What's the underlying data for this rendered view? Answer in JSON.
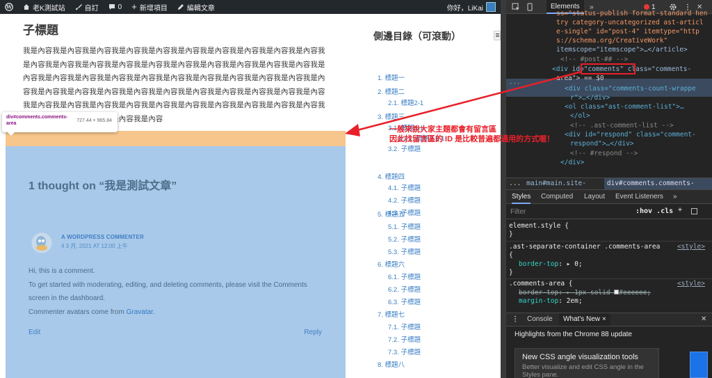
{
  "admin_bar": {
    "site_name": "老K測試站",
    "customize": "自訂",
    "comment_count": "0",
    "new_item": "新增項目",
    "edit_post": "編輯文章",
    "greeting": "你好，LiKai"
  },
  "post": {
    "sub_heading": "子標題",
    "body_text": "我是內容我是內容我是內容我是內容我是內容我是內容我是內容我是內容我是內容我是內容我是內容我是內容我是內容我是內容我是內容我是內容我是內容我是內容我是內容我是內容我是內容我是內容我是內容我是內容我是內容我是內容我是內容我是內容我是內容我是內容我是內容我是內容我是內容我是內容我是內容我是內容我是內容我是內容我是內容我是內容我是內容我是內容我是內容我是內容我是內容我是內容我是內容我是內容我是內容我是內容我是內容我是內容我是內容我是內容我是內容我是內容"
  },
  "inspect_tooltip": {
    "selector": "div#comments.comments-area",
    "size": "727.44 × 965.84"
  },
  "comments": {
    "title": "1 thought on “我是測試文章”",
    "commenter": "A WORDPRESS COMMENTER",
    "date": "4 3 月, 2021 AT 12:00 上午",
    "line1": "Hi, this is a comment.",
    "line2": "To get started with moderating, editing, and deleting comments, please visit the Comments",
    "line3": "screen in the dashboard.",
    "line4_prefix": "Commenter avatars come from ",
    "line4_link": "Gravatar",
    "line4_suffix": ".",
    "edit": "Edit",
    "reply": "Reply"
  },
  "toc": {
    "heading": "側邊目錄（可滾動）",
    "items": [
      {
        "label": "1. 標題一"
      },
      {
        "label": "2. 標題二"
      },
      {
        "label": "2.1. 標題2-1"
      },
      {
        "label": "3. 標題三"
      },
      {
        "label": "3.1. 標題3-1"
      },
      {
        "label": "3.1.1. 標題3-1-1"
      },
      {
        "label": "3.2. 子標題"
      },
      {
        "label": "4. 標題四"
      },
      {
        "label": "4.1. 子標題"
      },
      {
        "label": "4.2. 子標題"
      },
      {
        "label": "4.3. 子標題"
      },
      {
        "label": "5. 標題五"
      },
      {
        "label": "5.1. 子標題"
      },
      {
        "label": "5.2. 子標題"
      },
      {
        "label": "5.3. 子標題"
      },
      {
        "label": "6. 標題六"
      },
      {
        "label": "6.1. 子標題"
      },
      {
        "label": "6.2. 子標題"
      },
      {
        "label": "6.3. 子標題"
      },
      {
        "label": "7. 標題七"
      },
      {
        "label": "7.1. 子標題"
      },
      {
        "label": "7.2. 子標題"
      },
      {
        "label": "7.3. 子標題"
      },
      {
        "label": "8. 標題八"
      }
    ]
  },
  "annotation": {
    "line1": "一般來說大家主題都會有留言區",
    "line2": "因此找留言區的 ID 是比較普遍都通用的方式喔！",
    "color": "#e8202a"
  },
  "devtools": {
    "elements_tab": "Elements",
    "more_tabs": "»",
    "error_count": "1",
    "dom": {
      "l1": "ss=\"status-publish format-standard hen",
      "l2": "try category-uncategorized ast-articl",
      "l3": "e-single\" id=\"post-4\" itemtype=\"http",
      "l4": "s://schema.org/CreativeWork\"",
      "l5": "itemscope=\"itemscope\">…</article>",
      "l6": "<!-- #post-## -->",
      "sel_div": "<div ",
      "sel_id": "id=\"comments\"",
      "sel_class": " class=\"comments-",
      "sel2": "area\"> == $0",
      "l9": "<div class=\"comments-count-wrappe",
      "l10": "r\">…</div>",
      "l11": "<ol class=\"ast-comment-list\">…",
      "l12": "</ol>",
      "l13": "<!-- .ast-comment-list -->",
      "l14": "<div id=\"respond\" class=\"comment-",
      "l15": "respond\">…</div>",
      "l16": "<!-- #respond -->",
      "l17": "</div>"
    },
    "breadcrumbs": {
      "dots": "...",
      "main": "main#main.site-main",
      "current": "div#comments.comments-area"
    },
    "style_tabs": {
      "styles": "Styles",
      "computed": "Computed",
      "layout": "Layout",
      "listeners": "Event Listeners",
      "more": "»"
    },
    "filter_placeholder": "Filter",
    "hov_cls": ":hov .cls",
    "styles": {
      "r1_sel": "element.style {",
      "r1_end": "}",
      "r2_sel": ".ast-separate-container .comments-area",
      "r2_open": "{",
      "r2_prop": "border-top",
      "r2_val": "0;",
      "r2_end": "}",
      "r2_src": "<style>",
      "r3_sel": ".comments-area {",
      "r3_prop1": "border-top",
      "r3_val1": "1px solid ",
      "r3_val1b": "#eeeeee;",
      "r3_prop2": "margin-top",
      "r3_val2": "2em;",
      "r3_src": "<style>"
    },
    "drawer": {
      "console": "Console",
      "whatsnew": "What's New",
      "close": "×",
      "highlights": "Highlights from the Chrome 88 update",
      "card_title": "New CSS angle visualization tools",
      "card_desc": "Better visualize and edit CSS angle in the Styles pane."
    }
  }
}
